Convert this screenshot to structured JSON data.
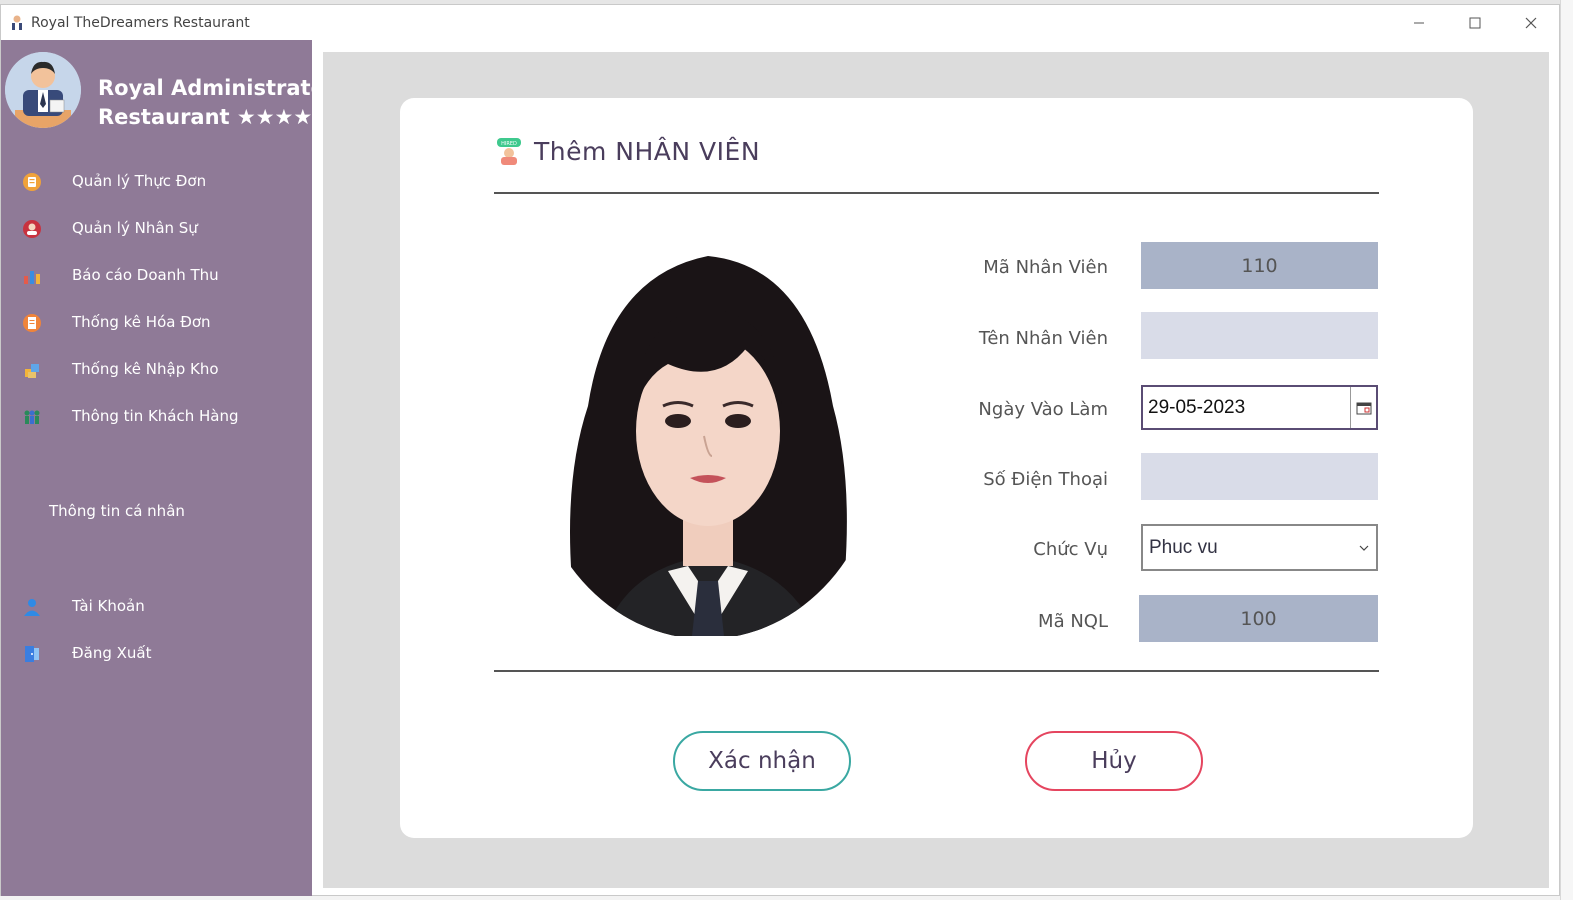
{
  "window": {
    "title": "Royal TheDreamers Restaurant"
  },
  "sidebar": {
    "brand_line1": "Royal Administrator",
    "brand_line2": "Restaurant ★★★★★",
    "items": [
      {
        "label": "Quản lý Thực Đơn",
        "icon": "menu-icon",
        "color": "#f0a23a"
      },
      {
        "label": "Quản lý Nhân Sự",
        "icon": "staff-icon",
        "color": "#c8323f"
      },
      {
        "label": "Báo cáo Doanh Thu",
        "icon": "revenue-chart-icon",
        "color": "#e45b4b"
      },
      {
        "label": "Thống kê Hóa Đơn",
        "icon": "invoice-icon",
        "color": "#f0843a"
      },
      {
        "label": "Thống kê Nhập Kho",
        "icon": "warehouse-icon",
        "color": "#f2b43a"
      },
      {
        "label": "Thông tin Khách Hàng",
        "icon": "customers-icon",
        "color": "#2a8a5a"
      }
    ],
    "section_label": "Thông tin cá nhân",
    "personal_items": [
      {
        "label": "Tài Khoản",
        "icon": "account-icon",
        "color": "#2f8ae5"
      },
      {
        "label": "Đăng Xuất",
        "icon": "logout-icon",
        "color": "#3a7ee0"
      }
    ]
  },
  "form": {
    "title": "Thêm NHÂN VIÊN",
    "labels": {
      "employee_id": "Mã Nhân Viên",
      "employee_name": "Tên Nhân Viên",
      "start_date": "Ngày Vào Làm",
      "phone": "Số Điện Thoại",
      "position": "Chức Vụ",
      "manager_id": "Mã NQL"
    },
    "values": {
      "employee_id": "110",
      "employee_name": "",
      "start_date": "29-05-2023",
      "phone": "",
      "position": "Phuc vu",
      "manager_id": "100"
    },
    "confirm_label": "Xác nhận",
    "cancel_label": "Hủy"
  },
  "colors": {
    "sidebar_bg": "#8f7a97",
    "readonly_field": "#a9b3c8",
    "empty_field": "#d9dce8",
    "confirm_border": "#3aa8a2",
    "cancel_border": "#e5455f"
  }
}
